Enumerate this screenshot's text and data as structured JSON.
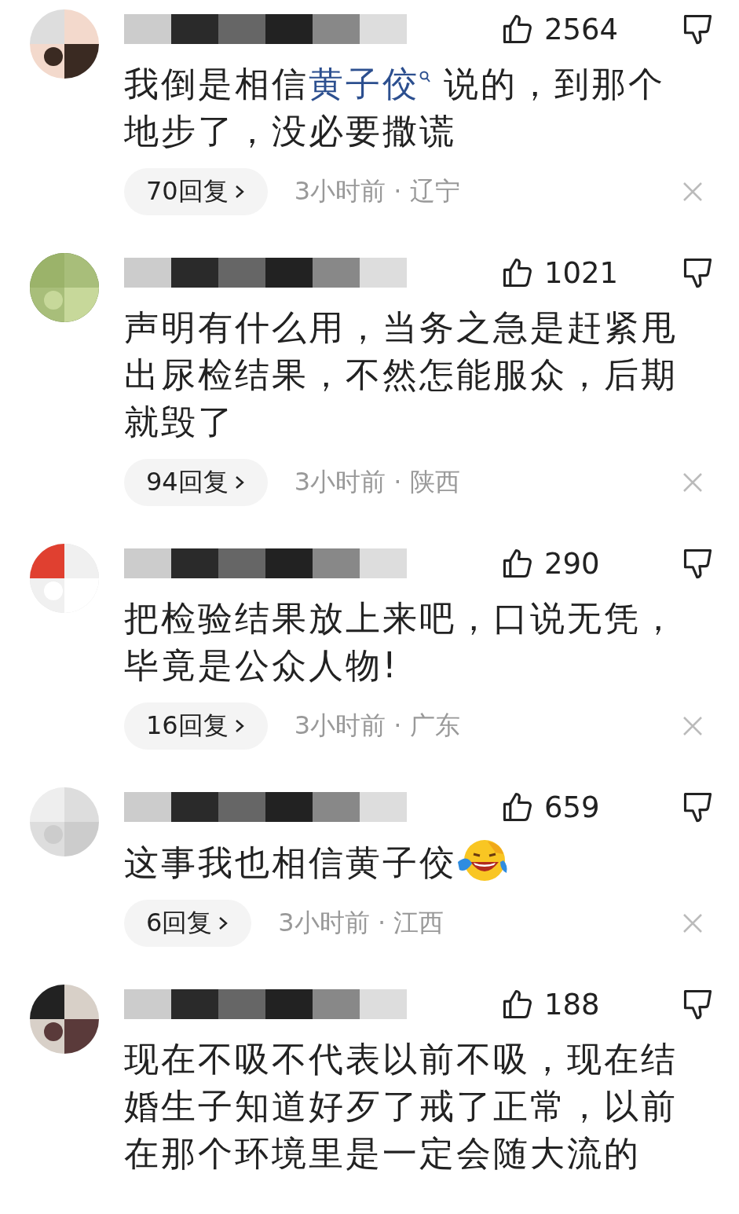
{
  "comments": [
    {
      "likes": "2564",
      "text": [
        {
          "kind": "plain",
          "text": "我倒是相信"
        },
        {
          "kind": "link",
          "text": "黄子佼"
        },
        {
          "kind": "plain",
          "text": " 说的，到那个地步了，没必要撒谎"
        }
      ],
      "replies": "70回复",
      "time": "3小时前 · 辽宁"
    },
    {
      "likes": "1021",
      "text": [
        {
          "kind": "plain",
          "text": "声明有什么用，当务之急是赶紧甩出尿检结果，不然怎能服众，后期就毁了"
        }
      ],
      "replies": "94回复",
      "time": "3小时前 · 陕西"
    },
    {
      "likes": "290",
      "text": [
        {
          "kind": "plain",
          "text": "把检验结果放上来吧，口说无凭，毕竟是公众人物!"
        }
      ],
      "replies": "16回复",
      "time": "3小时前 · 广东"
    },
    {
      "likes": "659",
      "text": [
        {
          "kind": "plain",
          "text": "这事我也相信黄子佼"
        },
        {
          "kind": "emoji"
        }
      ],
      "replies": "6回复",
      "time": "3小时前 · 江西"
    },
    {
      "likes": "188",
      "text": [
        {
          "kind": "plain",
          "text": "现在不吸不代表以前不吸，现在结婚生子知道好歹了戒了正常，以前在那个环境里是一定会随大流的"
        }
      ]
    }
  ]
}
